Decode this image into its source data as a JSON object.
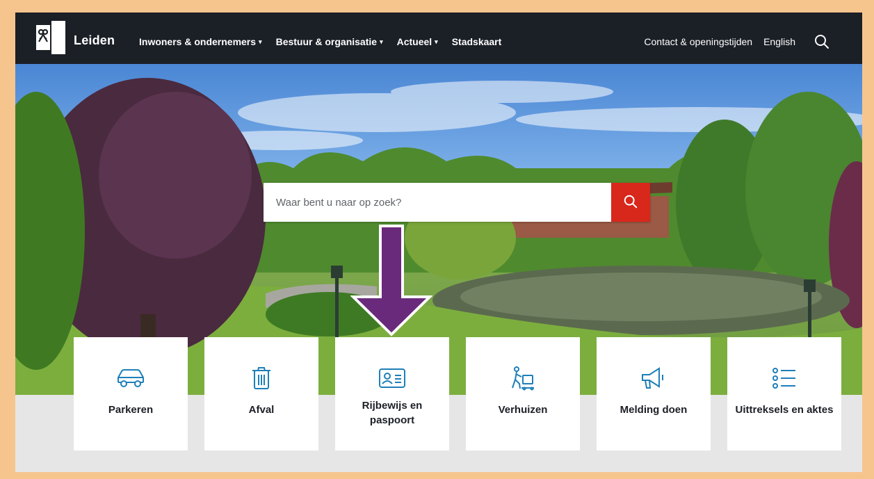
{
  "header": {
    "brand": "Leiden",
    "nav": [
      {
        "label": "Inwoners & ondernemers",
        "has_dropdown": true
      },
      {
        "label": "Bestuur & organisatie",
        "has_dropdown": true
      },
      {
        "label": "Actueel",
        "has_dropdown": true
      },
      {
        "label": "Stadskaart",
        "has_dropdown": false
      }
    ],
    "caret": "▾",
    "utility": {
      "contact": "Contact & openingstijden",
      "language": "English"
    },
    "icons": {
      "logo": "leiden-keys-logo-icon",
      "search": "search-icon"
    }
  },
  "search": {
    "placeholder": "Waar bent u naar op zoek?",
    "value": "",
    "button_icon": "search-icon"
  },
  "tiles": [
    {
      "label": "Parkeren",
      "icon": "car-icon"
    },
    {
      "label": "Afval",
      "icon": "trash-bin-icon"
    },
    {
      "label": "Rijbewijs en paspoort",
      "icon": "id-card-icon"
    },
    {
      "label": "Verhuizen",
      "icon": "moving-person-icon"
    },
    {
      "label": "Melding doen",
      "icon": "megaphone-icon"
    },
    {
      "label": "Uittreksels en aktes",
      "icon": "list-icon"
    }
  ],
  "colors": {
    "header_bg": "#1b1f26",
    "search_button": "#d8271b",
    "icon_accent": "#1d7fb8",
    "annotation_arrow": "#6a2a7b",
    "frame_border": "#f6c58e"
  }
}
